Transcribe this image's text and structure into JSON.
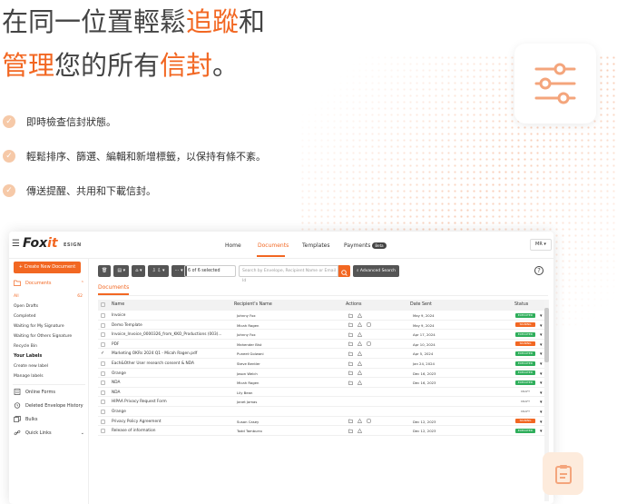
{
  "hero": {
    "line1_a": "在同一位置輕鬆",
    "line1_hl": "追蹤",
    "line1_b": "和",
    "line2_hl1": "管理",
    "line2_a": "您的所有",
    "line2_hl2": "信封",
    "line2_b": "。"
  },
  "bullets": [
    "即時檢查信封狀態。",
    "輕鬆排序、篩選、編輯和新增標籤，以保持有條不紊。",
    "傳送提醒、共用和下載信封。"
  ],
  "app": {
    "logo_text": "Fox",
    "logo_x": "it",
    "logo_sub": "ESIGN",
    "nav": {
      "home": "Home",
      "documents": "Documents",
      "templates": "Templates",
      "payments": "Payments",
      "beta": "Beta"
    },
    "user_initials": "MR ▾",
    "new_doc": "+ Create New Document",
    "sidebar": {
      "documents": "Documents",
      "items": [
        {
          "label": "All",
          "count": "62"
        },
        {
          "label": "Open Drafts"
        },
        {
          "label": "Completed"
        },
        {
          "label": "Waiting for My Signature"
        },
        {
          "label": "Waiting for Others Signature"
        },
        {
          "label": "Recycle Bin"
        }
      ],
      "your_labels": "Your Labels",
      "label_items": [
        "Create new label",
        "Manage labels"
      ],
      "online_forms": "Online Forms",
      "deleted_history": "Deleted Envelope History",
      "bulks": "Bulks",
      "quick_links": "Quick Links"
    },
    "toolbar": {
      "selected": "6 of 6 selected",
      "search_placeholder": "Search by Envelope, Recipient Name or Email Id",
      "advanced": "Advanced Search",
      "help": "?"
    },
    "tab_documents": "Documents",
    "columns": {
      "name": "Name",
      "recipient": "Recipient's Name",
      "actions": "Actions",
      "date": "Date Sent",
      "status": "Status"
    },
    "rows": [
      {
        "name": "Invoice",
        "recipient": "Johnny Fox",
        "date": "May 9, 2024",
        "status": "EXECUTED",
        "type": "executed",
        "checked": false,
        "icons": 2
      },
      {
        "name": "Demo Template",
        "recipient": "Micah Ragen",
        "date": "May 9, 2024",
        "status": "SIGNING",
        "type": "signing",
        "checked": false,
        "icons": 3
      },
      {
        "name": "Invoice_Invoice_0000326_from_KKO_Productions (003)...",
        "recipient": "Johnny Fox",
        "date": "Apr 17, 2024",
        "status": "EXECUTED",
        "type": "executed",
        "checked": false,
        "icons": 2
      },
      {
        "name": "PDF",
        "recipient": "Mahender Bist",
        "date": "Apr 10, 2024",
        "status": "SIGNING",
        "type": "signing",
        "checked": false,
        "icons": 3
      },
      {
        "name": "Marketing OKRs 2024 Q1 - Micah Ragen.pdf",
        "recipient": "Puneet Golwani",
        "date": "Apr 5, 2024",
        "status": "EXECUTED",
        "type": "executed",
        "checked": true,
        "icons": 2
      },
      {
        "name": "Each&Other User research consent & NDA",
        "recipient": "Steve Bentler",
        "date": "Jan 24, 2024",
        "status": "EXECUTED",
        "type": "executed",
        "checked": false,
        "icons": 2
      },
      {
        "name": "Orange",
        "recipient": "Jason Welch",
        "date": "Dec 16, 2023",
        "status": "EXECUTED",
        "type": "executed",
        "checked": false,
        "icons": 2
      },
      {
        "name": "NDA",
        "recipient": "Micah Ragen",
        "date": "Dec 16, 2023",
        "status": "EXECUTED",
        "type": "executed",
        "checked": false,
        "icons": 2
      },
      {
        "name": "NDA",
        "recipient": "Lily Bean",
        "date": "",
        "status": "DRAFT",
        "type": "draft",
        "checked": false,
        "icons": 0
      },
      {
        "name": "HIPAA Privacy Request Form",
        "recipient": "Janet Jamas",
        "date": "",
        "status": "DRAFT",
        "type": "draft",
        "checked": false,
        "icons": 0
      },
      {
        "name": "Orange",
        "recipient": "",
        "date": "",
        "status": "DRAFT",
        "type": "draft",
        "checked": false,
        "icons": 0
      },
      {
        "name": "Privacy Policy Agreement",
        "recipient": "Susan Casey",
        "date": "Dec 12, 2023",
        "status": "SIGNING",
        "type": "signing",
        "checked": false,
        "icons": 3
      },
      {
        "name": "Release of information",
        "recipient": "Todd Tamburro",
        "date": "Dec 12, 2023",
        "status": "EXECUTED",
        "type": "executed",
        "checked": false,
        "icons": 2
      }
    ]
  },
  "colors": {
    "accent": "#f26722",
    "executed": "#2fae5b",
    "text": "#444444"
  }
}
